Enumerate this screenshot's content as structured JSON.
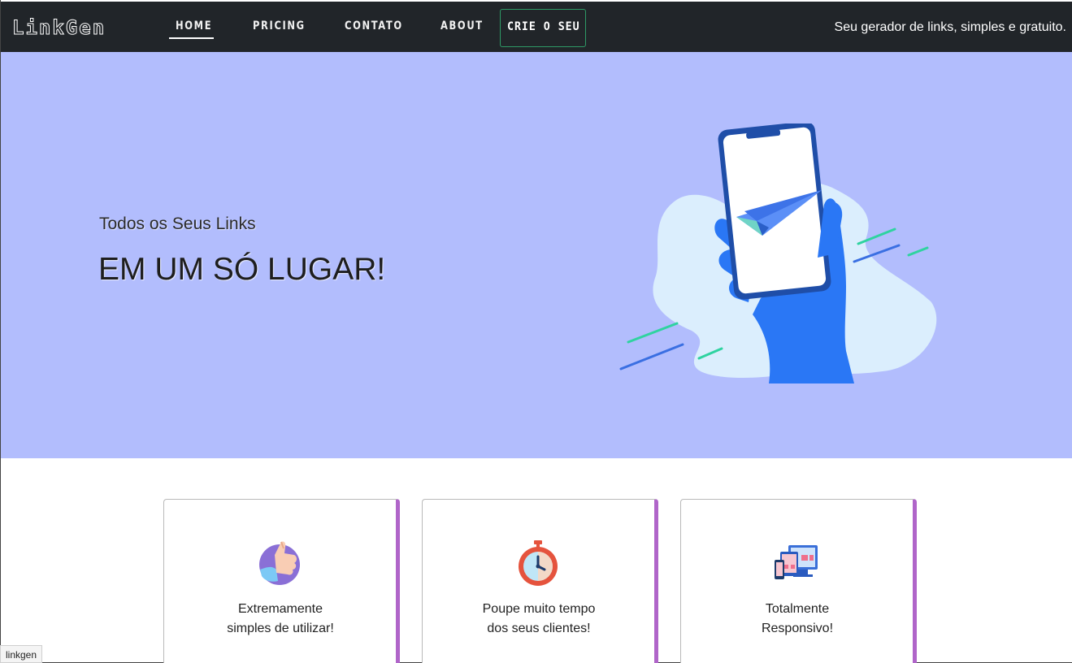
{
  "navbar": {
    "brand": "LinkGen",
    "items": [
      {
        "label": "HOME",
        "active": true
      },
      {
        "label": "PRICING"
      },
      {
        "label": "CONTATO"
      },
      {
        "label": "ABOUT"
      }
    ],
    "cta_label": "CRIE O SEU",
    "tagline": "Seu gerador de links, simples e gratuito."
  },
  "hero": {
    "subtitle": "Todos os Seus Links",
    "title": "EM UM SÓ LUGAR!",
    "background": "#b2bdfd",
    "illustration_icon": "hand-phone-paper-plane-icon"
  },
  "features": [
    {
      "icon": "thumbs-up-icon",
      "line1": "Extremamente",
      "line2": "simples de utilizar!"
    },
    {
      "icon": "stopwatch-icon",
      "line1": "Poupe muito tempo",
      "line2": "dos seus clientes!"
    },
    {
      "icon": "responsive-devices-icon",
      "line1": "Totalmente",
      "line2": "Responsivo!"
    }
  ],
  "status_tooltip": "linkgen",
  "colors": {
    "navbar": "#212529",
    "cta_border": "#2e9a66",
    "card_accent": "#b065c9",
    "hero": "#b2bdfd"
  }
}
